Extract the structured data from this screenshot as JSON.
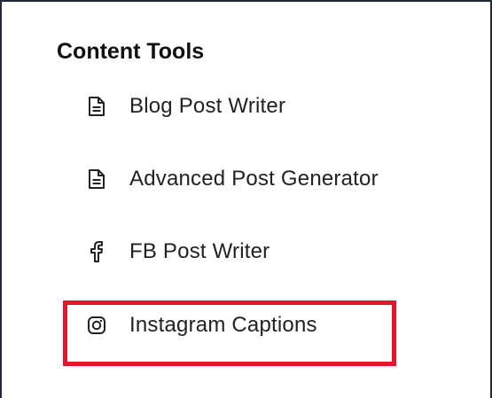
{
  "sidebar": {
    "section_title": "Content Tools",
    "items": [
      {
        "label": "Blog Post Writer",
        "icon": "document-icon"
      },
      {
        "label": "Advanced Post Generator",
        "icon": "document-icon"
      },
      {
        "label": "FB Post Writer",
        "icon": "facebook-icon"
      },
      {
        "label": "Instagram Captions",
        "icon": "instagram-icon"
      }
    ],
    "highlighted_item": "Instagram Captions"
  },
  "colors": {
    "text": "#222222",
    "border": "#1f2937",
    "highlight": "#e3162b"
  }
}
